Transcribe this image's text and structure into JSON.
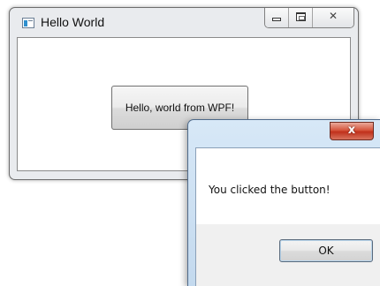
{
  "main_window": {
    "title": "Hello World",
    "app_icon": "window-app-icon",
    "caption": {
      "minimize_icon": "minimize-icon",
      "maximize_icon": "maximize-icon",
      "close_glyph": "✕"
    },
    "button_label": "Hello, world from WPF!"
  },
  "message_box": {
    "close_glyph": "x",
    "message": "You clicked the button!",
    "ok_label": "OK"
  },
  "colors": {
    "close_button_red": "#c0301b",
    "titlebar_blue": "#c3d9ee"
  }
}
